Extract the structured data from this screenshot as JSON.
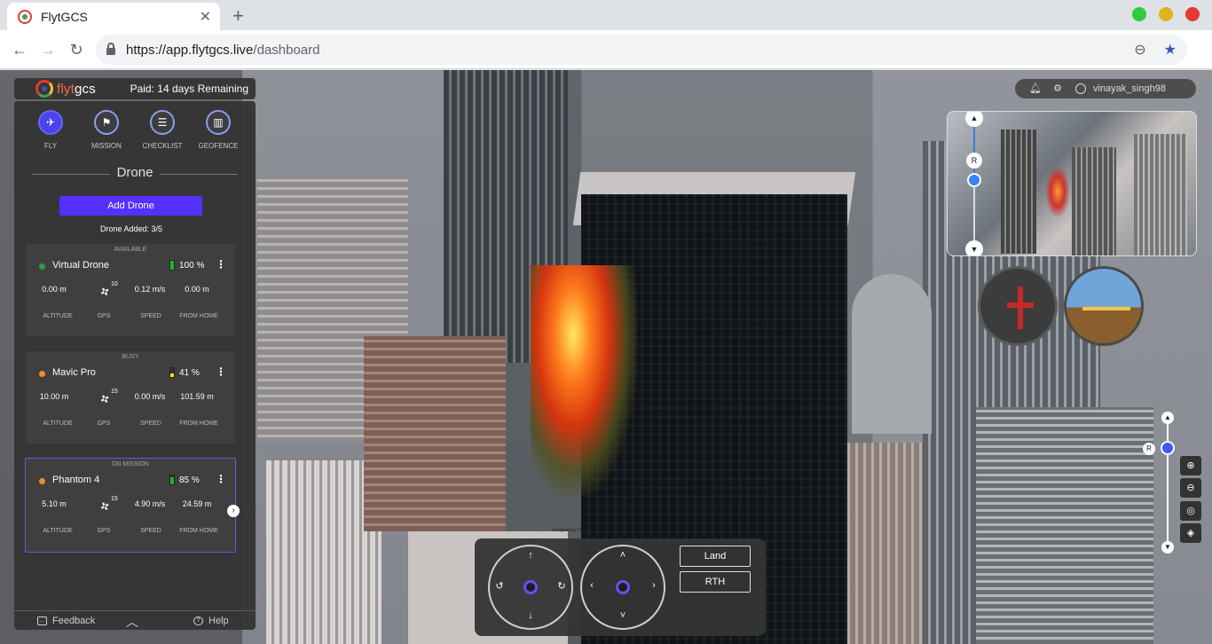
{
  "browser": {
    "tab_title": "FlytGCS",
    "url_host": "https://app.flytgcs.live",
    "url_path": "/dashboard"
  },
  "header": {
    "logo_prefix": "flyt",
    "logo_suffix": "gcs",
    "paid_status": "Paid: 14 days Remaining",
    "username": "vinayak_singh98"
  },
  "modes": [
    {
      "label": "FLY",
      "icon": "plane-icon"
    },
    {
      "label": "MISSION",
      "icon": "flag-icon"
    },
    {
      "label": "CHECKLIST",
      "icon": "checklist-icon"
    },
    {
      "label": "GEOFENCE",
      "icon": "geofence-icon"
    }
  ],
  "panel": {
    "title": "Drone",
    "add_button": "Add Drone",
    "drone_count": "Drone Added: 3/5"
  },
  "drones": [
    {
      "status": "AVAILABLE",
      "name": "Virtual Drone",
      "dot_color": "#2ea043",
      "battery": "100 %",
      "battery_level": 1.0,
      "battery_color": "#19b832",
      "altitude": "0.00 m",
      "gps": "10",
      "speed": "0.12 m/s",
      "from_home": "0.00 m"
    },
    {
      "status": "BUSY",
      "name": "Mavic Pro",
      "dot_color": "#f08c2e",
      "battery": "41 %",
      "battery_level": 0.41,
      "battery_color": "#f5e50b",
      "altitude": "10.00 m",
      "gps": "15",
      "speed": "0.00 m/s",
      "from_home": "101.59 m"
    },
    {
      "status": "ON MISSION",
      "name": "Phantom 4",
      "dot_color": "#f08c2e",
      "battery": "85 %",
      "battery_level": 0.85,
      "battery_color": "#19b832",
      "altitude": "5.10 m",
      "gps": "15",
      "speed": "4.90 m/s",
      "from_home": "24.59 m"
    }
  ],
  "stat_labels": {
    "altitude": "ALTITUDE",
    "gps": "GPS",
    "speed": "SPEED",
    "from_home": "FROM HOME"
  },
  "footer": {
    "feedback": "Feedback",
    "help": "Help"
  },
  "minimap": {
    "rotate_label": "R"
  },
  "zoom": {
    "rotate_label": "R"
  },
  "controls": {
    "land": "Land",
    "rth": "RTH"
  },
  "map": {
    "watermark": "Designed by Freepik"
  },
  "colors": {
    "accent": "#5530ff",
    "panel_bg": "#343434"
  }
}
